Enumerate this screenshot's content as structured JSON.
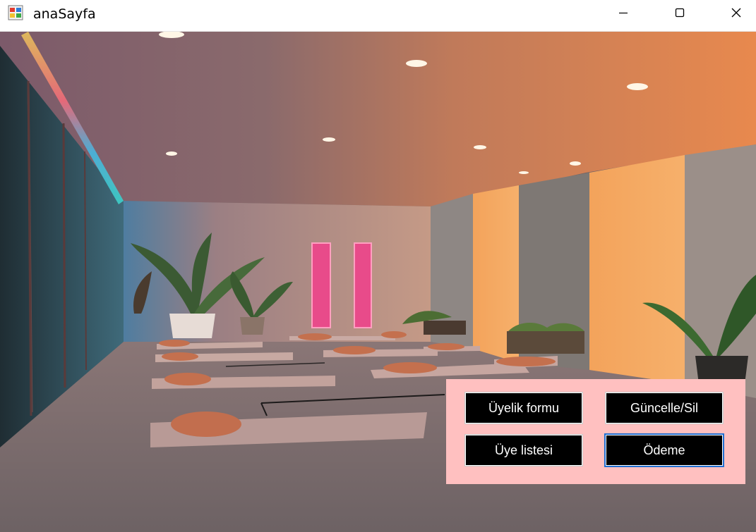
{
  "window": {
    "title": "anaSayfa",
    "controls": [
      "minimize",
      "maximize",
      "close"
    ]
  },
  "icons": {
    "app": "app-icon",
    "minimize": "minimize-icon",
    "maximize": "maximize-icon",
    "close": "close-icon"
  },
  "background": {
    "description_icon": "background-image",
    "colors": {
      "left_glow": "#3bb3d9",
      "warm_glow": "#f2a25a",
      "floor": "#7a6c6e",
      "mat": "#b89a96",
      "cushion": "#c57a5a"
    }
  },
  "panel": {
    "color": "#ffc0c0",
    "buttons": {
      "uyelik_formu": "Üyelik formu",
      "guncelle_sil": "Güncelle/Sil",
      "uye_listesi": "Üye listesi",
      "odeme": "Ödeme"
    }
  }
}
